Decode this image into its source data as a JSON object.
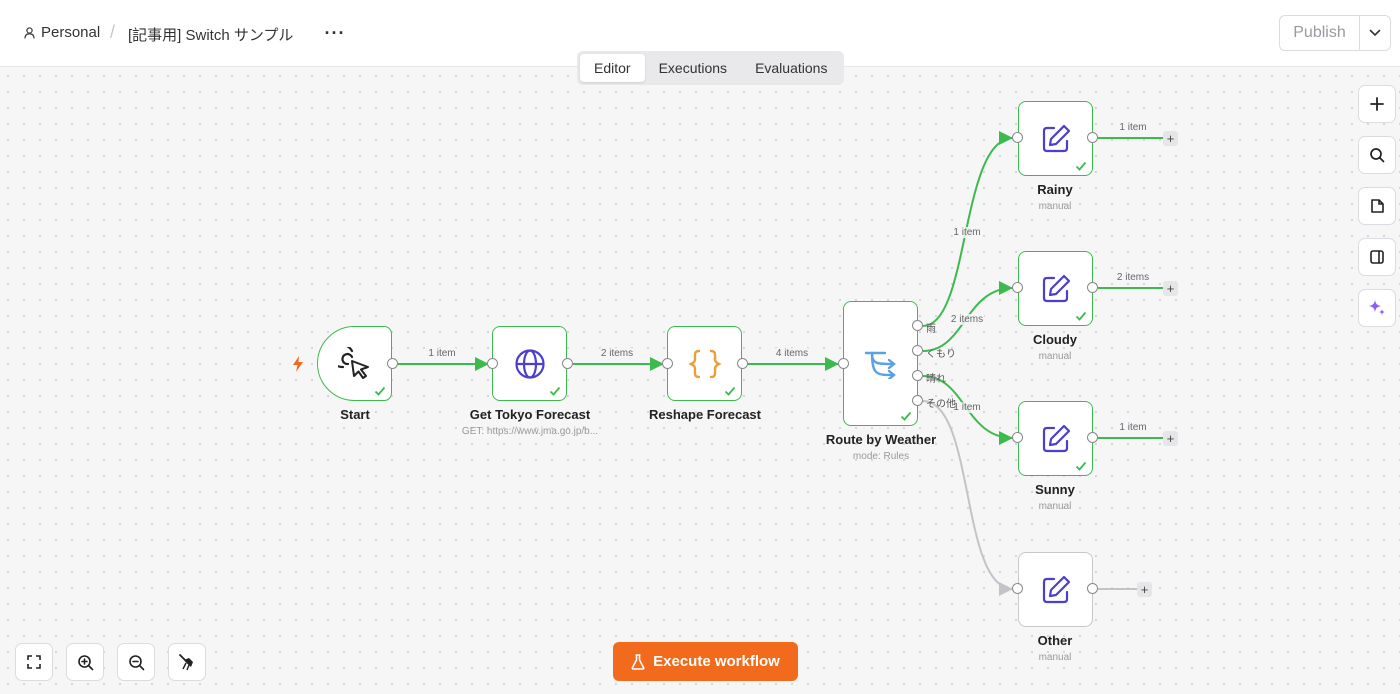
{
  "header": {
    "personal": "Personal",
    "separator": "/",
    "workflow_title": "[記事用] Switch サンプル",
    "more": "···",
    "publish": "Publish"
  },
  "tabs": [
    {
      "label": "Editor",
      "active": true
    },
    {
      "label": "Executions",
      "active": false
    },
    {
      "label": "Evaluations",
      "active": false
    }
  ],
  "nodes": {
    "start": {
      "label": "Start",
      "icon": "cursor-click-icon"
    },
    "get_forecast": {
      "label": "Get Tokyo Forecast",
      "subtitle": "GET: https://www.jma.go.jp/b...",
      "icon": "globe-icon"
    },
    "reshape": {
      "label": "Reshape Forecast",
      "icon": "code-braces-icon"
    },
    "route": {
      "label": "Route by Weather",
      "subtitle": "mode: Rules",
      "icon": "switch-icon",
      "outputs": [
        "雨",
        "くもり",
        "晴れ",
        "その他"
      ]
    },
    "rainy": {
      "label": "Rainy",
      "subtitle": "manual",
      "icon": "edit-icon"
    },
    "cloudy": {
      "label": "Cloudy",
      "subtitle": "manual",
      "icon": "edit-icon"
    },
    "sunny": {
      "label": "Sunny",
      "subtitle": "manual",
      "icon": "edit-icon"
    },
    "other": {
      "label": "Other",
      "subtitle": "manual",
      "icon": "edit-icon"
    }
  },
  "edges": {
    "start_to_get": "1 item",
    "get_to_reshape": "2 items",
    "reshape_to_route": "4 items",
    "route_to_rainy": "1 item",
    "route_to_cloudy": "2 items",
    "route_to_sunny": "1 item",
    "rainy_out": "1 item",
    "cloudy_out": "2 items",
    "sunny_out": "1 item"
  },
  "plus": "+",
  "execute_button": "Execute workflow",
  "colors": {
    "success": "#3dba4e",
    "accent": "#f26a1b",
    "node_icon": "#4b3fce",
    "code_icon": "#e8a13a",
    "switch_icon": "#5aa2e0"
  }
}
